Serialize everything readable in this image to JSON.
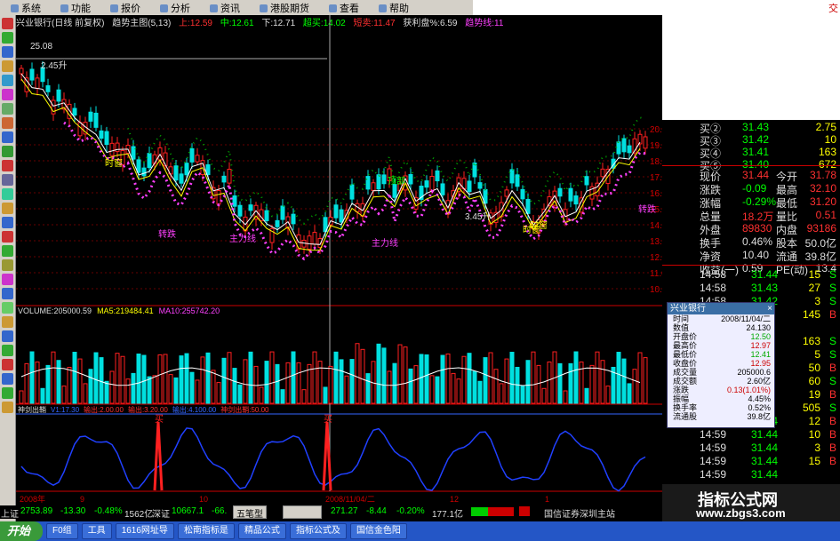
{
  "menu": [
    {
      "label": "系统"
    },
    {
      "label": "功能"
    },
    {
      "label": "报价"
    },
    {
      "label": "分析"
    },
    {
      "label": "资讯"
    },
    {
      "label": "港股期货"
    },
    {
      "label": "查看"
    },
    {
      "label": "帮助"
    }
  ],
  "menu_right_label": "交",
  "title_line": {
    "stock": "兴业银行(日线 前复权)",
    "indicator": "趋势主图(5,13)",
    "up": "上:12.59",
    "mid": "中:12.61",
    "down": "下:12.71",
    "overbuy": "超买:14.02",
    "ultra": "短卖:11.47",
    "profit": "获利盘%:6.59",
    "trend": "趋势线:11"
  },
  "colors": {
    "up": "#ff2020",
    "down": "#00e0e0",
    "bg": "#000000",
    "axis": "#c00000",
    "yellow": "#ffff00",
    "purple": "#ff40ff",
    "green": "#00ff00"
  },
  "price_axis": {
    "labels": [
      "20.00",
      "19.00",
      "18.00",
      "17.00",
      "16.00",
      "15.00",
      "14.00",
      "13.00",
      "12.00",
      "11.00",
      "10.00"
    ]
  },
  "price_annotations": [
    {
      "text": "25.08"
    },
    {
      "text": "2.45升"
    },
    {
      "text": "时窗"
    },
    {
      "text": "时窗"
    },
    {
      "text": "顶部"
    },
    {
      "text": "3.45升"
    },
    {
      "text": "时窗"
    },
    {
      "text": "主力线"
    },
    {
      "text": "主力线"
    },
    {
      "text": "转跌"
    },
    {
      "text": "转跌"
    }
  ],
  "volume_label": {
    "vol": "VOLUME:205000.59",
    "ma5": "MA5:219484.41",
    "ma10": "MA10:255742.20"
  },
  "osc_label": {
    "name": "神剑出鞘",
    "v1": "V1:17.30",
    "v2": "输出:2.00.00",
    "v3": "输出:3.20.00",
    "v4": "输出:4.100.00",
    "v5": "神剑出鞘:50.00"
  },
  "osc_marks": [
    "买",
    "买"
  ],
  "date_axis": [
    "2008年",
    "9",
    "10",
    "2008/11/04/二",
    "12",
    "1"
  ],
  "quote": {
    "buy": [
      {
        "label": "买②",
        "price": "31.43",
        "vol": "2.75"
      },
      {
        "label": "买③",
        "price": "31.42",
        "vol": "10"
      },
      {
        "label": "买④",
        "price": "31.41",
        "vol": "163"
      },
      {
        "label": "买⑤",
        "price": "31.40",
        "vol": "672"
      }
    ],
    "stats": [
      {
        "l1": "现价",
        "v1": "31.44",
        "l2": "今开",
        "v2": "31.78"
      },
      {
        "l1": "涨跌",
        "v1": "-0.09",
        "l2": "最高",
        "v2": "32.10"
      },
      {
        "l1": "涨幅",
        "v1": "-0.29%",
        "l2": "最低",
        "v2": "31.20"
      },
      {
        "l1": "总量",
        "v1": "18.2万",
        "l2": "量比",
        "v2": "0.51"
      },
      {
        "l1": "外盘",
        "v1": "89830",
        "l2": "内盘",
        "v2": "93186"
      },
      {
        "l1": "换手",
        "v1": "0.46%",
        "l2": "股本",
        "v2": "50.0亿"
      },
      {
        "l1": "净资",
        "v1": "10.40",
        "l2": "流通",
        "v2": "39.8亿"
      },
      {
        "l1": "收益(一)",
        "v1": "0.59",
        "l2": "PE(动)",
        "v2": "13.4"
      }
    ],
    "ticks": [
      {
        "t": "14:58",
        "p": "31.44",
        "v": "15",
        "s": "S"
      },
      {
        "t": "14:58",
        "p": "31.43",
        "v": "27",
        "s": "S"
      },
      {
        "t": "14:58",
        "p": "31.42",
        "v": "3",
        "s": "S"
      },
      {
        "t": "14:58",
        "p": "",
        "v": "145",
        "s": "B"
      },
      {
        "t": "",
        "p": "",
        "v": "",
        "s": ""
      },
      {
        "t": "",
        "p": "",
        "v": "163",
        "s": "S"
      },
      {
        "t": "",
        "p": "",
        "v": "5",
        "s": "S"
      },
      {
        "t": "",
        "p": "",
        "v": "50",
        "s": "B"
      },
      {
        "t": "",
        "p": "",
        "v": "60",
        "s": "S"
      },
      {
        "t": "",
        "p": "",
        "v": "19",
        "s": "B"
      },
      {
        "t": "",
        "p": "",
        "v": "505",
        "s": "S"
      },
      {
        "t": "14:59",
        "p": "31.44",
        "v": "12",
        "s": "B"
      },
      {
        "t": "14:59",
        "p": "31.44",
        "v": "10",
        "s": "B"
      },
      {
        "t": "14:59",
        "p": "31.44",
        "v": "3",
        "s": "B"
      },
      {
        "t": "14:59",
        "p": "31.44",
        "v": "15",
        "s": "B"
      },
      {
        "t": "14:59",
        "p": "31.44",
        "v": "",
        "s": ""
      }
    ]
  },
  "popup": {
    "title": "兴业银行",
    "close": "×",
    "rows": [
      {
        "l": "时间",
        "v": "2008/11/04/二"
      },
      {
        "l": "数值",
        "v": "24.130"
      },
      {
        "l": "开盘价",
        "v": "12.50"
      },
      {
        "l": "最高价",
        "v": "12.97"
      },
      {
        "l": "最低价",
        "v": "12.41"
      },
      {
        "l": "收盘价",
        "v": "12.95"
      },
      {
        "l": "成交量",
        "v": "205000.6"
      },
      {
        "l": "成交额",
        "v": "2.60亿"
      },
      {
        "l": "涨跌",
        "v": "0.13(1.01%)"
      },
      {
        "l": "振幅",
        "v": "4.45%"
      },
      {
        "l": "换手率",
        "v": "0.52%"
      },
      {
        "l": "流通股",
        "v": "39.8亿"
      }
    ]
  },
  "index_bar": {
    "sh_label": "上证",
    "sh_val": "2753.89",
    "sh_chg": "-13.30",
    "sh_pct": "-0.48%",
    "sh_amt": "1562亿",
    "sz_label": "深证",
    "sz_val": "10667.1",
    "sz_chg": "-66.",
    "tab": "五笔型",
    "v2": "271.27",
    "c2": "-8.44",
    "p2": "-0.20%",
    "a2": "177.1亿",
    "broker": "国信证券深圳主站"
  },
  "taskbar": {
    "start": "开始",
    "tasks": [
      "F0组",
      "工具",
      "1616网址导",
      "松南指标是",
      "精品公式",
      "指标公式及",
      "国信金色阳"
    ]
  },
  "watermark": {
    "title": "指标公式网",
    "url": "www.zbgs3.com"
  }
}
